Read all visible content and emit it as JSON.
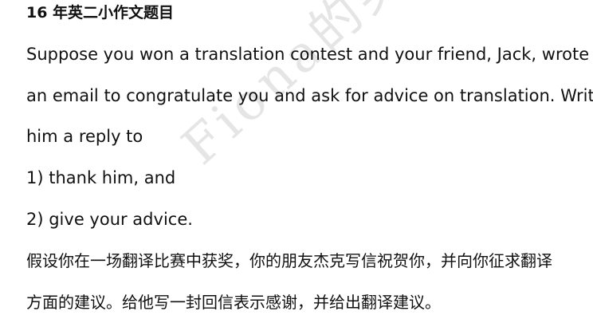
{
  "document": {
    "title": "16 年英二小作文题目",
    "watermark": "Fiona的英",
    "lines": [
      "Suppose you won a translation contest and your friend, Jack, wrote",
      "an email to congratulate you and ask for advice on translation. Write",
      "him a reply to",
      "1) thank him, and",
      "2) give your advice.",
      "假设你在一场翻译比赛中获奖，你的朋友杰克写信祝贺你，并向你征求翻译",
      "方面的建议。给他写一封回信表示感谢，并给出翻译建议。"
    ]
  }
}
